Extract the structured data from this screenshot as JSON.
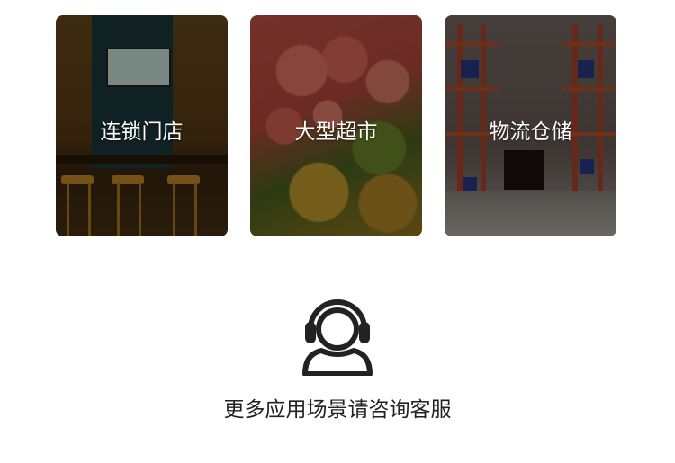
{
  "scenarios": [
    {
      "label": "连锁门店",
      "image": "chain-store-photo"
    },
    {
      "label": "大型超市",
      "image": "supermarket-produce-photo"
    },
    {
      "label": "物流仓储",
      "image": "warehouse-racks-photo"
    }
  ],
  "service": {
    "icon": "customer-service-headset-icon",
    "text": "更多应用场景请咨询客服"
  },
  "colors": {
    "background": "#ffffff",
    "text": "#222222",
    "card_label": "#ffffff",
    "overlay": "rgba(0,0,0,0.42)"
  }
}
